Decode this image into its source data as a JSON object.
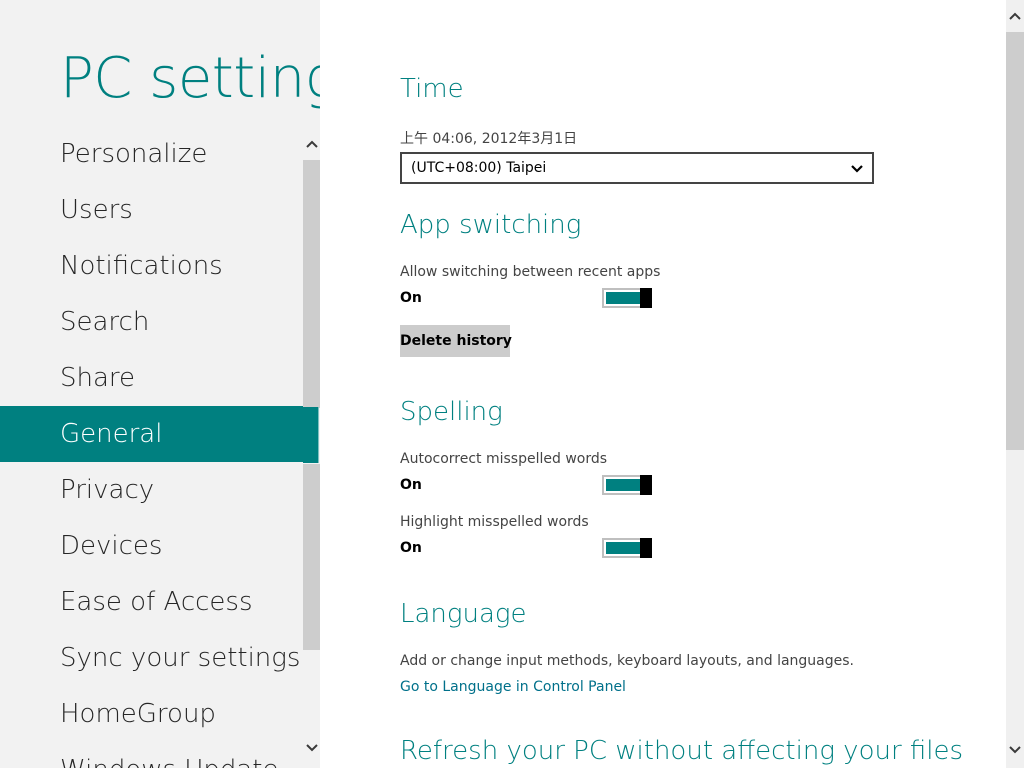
{
  "app": {
    "title": "PC settings"
  },
  "sidebar": {
    "items": [
      {
        "label": "Personalize"
      },
      {
        "label": "Users"
      },
      {
        "label": "Notifications"
      },
      {
        "label": "Search"
      },
      {
        "label": "Share"
      },
      {
        "label": "General",
        "selected": true
      },
      {
        "label": "Privacy"
      },
      {
        "label": "Devices"
      },
      {
        "label": "Ease of Access"
      },
      {
        "label": "Sync your settings"
      },
      {
        "label": "HomeGroup"
      },
      {
        "label": "Windows Update"
      }
    ]
  },
  "main": {
    "time": {
      "title": "Time",
      "datetime": "上午 04:06, 2012年3月1日",
      "timezone_value": "(UTC+08:00) Taipei"
    },
    "app_switching": {
      "title": "App switching",
      "allow_label": "Allow switching between recent apps",
      "allow_state": "On",
      "delete_label": "Delete history"
    },
    "spelling": {
      "title": "Spelling",
      "autocorrect_label": "Autocorrect misspelled words",
      "autocorrect_state": "On",
      "highlight_label": "Highlight misspelled words",
      "highlight_state": "On"
    },
    "language": {
      "title": "Language",
      "description": "Add or change input methods, keyboard layouts, and languages.",
      "link": "Go to Language in Control Panel"
    },
    "refresh": {
      "title": "Refresh your PC without affecting your files"
    }
  },
  "colors": {
    "accent": "#008080",
    "sidebar_bg": "#f2f2f2",
    "toggle_knob": "#000000"
  },
  "icons": {
    "dropdown": "chevron-down-icon",
    "scroll_up": "chevron-up-icon",
    "scroll_down": "chevron-down-icon"
  }
}
